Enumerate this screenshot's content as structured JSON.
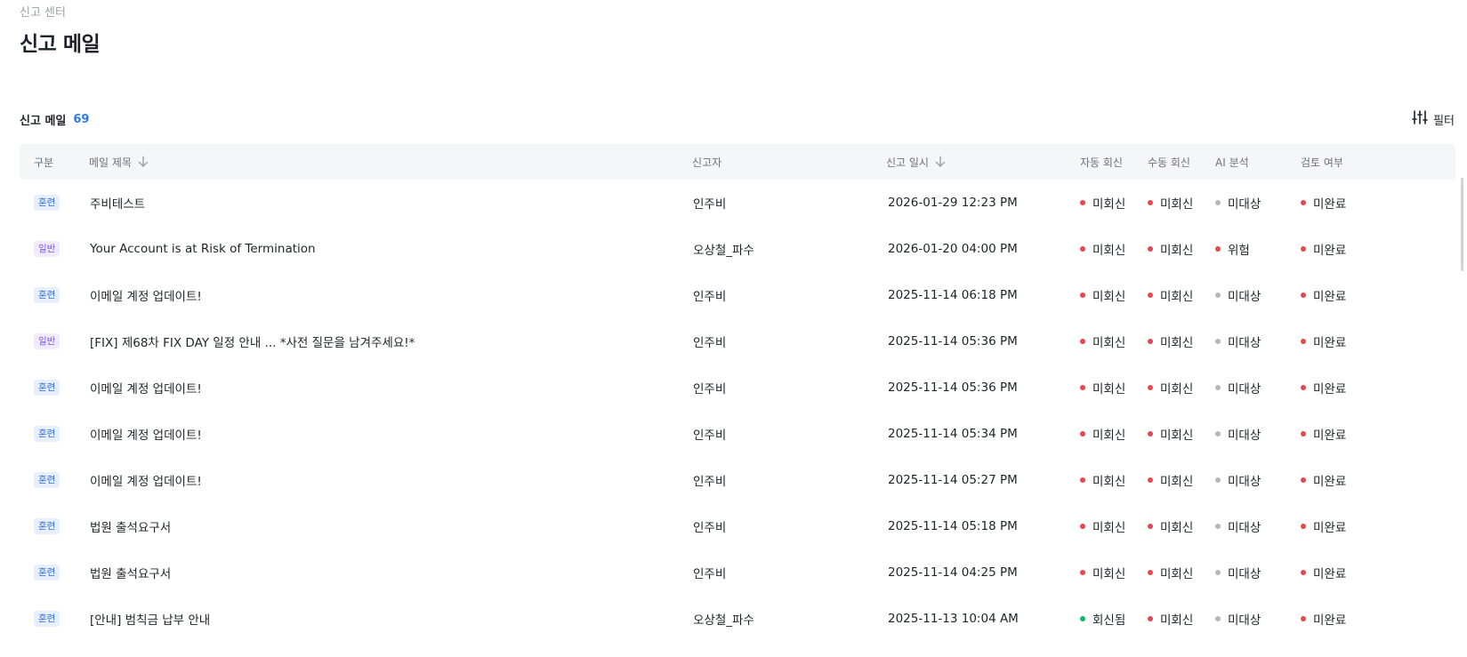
{
  "breadcrumb": "신고 센터",
  "page_title": "신고 메일",
  "list": {
    "label": "신고 메일",
    "count": "69",
    "filter_label": "필터",
    "filter_icon": "sliders-icon"
  },
  "columns": {
    "category": "구분",
    "subject": "메일 제목",
    "reporter": "신고자",
    "reported_at": "신고 일시",
    "auto_reply": "자동 회신",
    "manual_reply": "수동 회신",
    "ai_analysis": "AI 분석",
    "review": "검토 여부"
  },
  "colors": {
    "red": "#e5484d",
    "gray": "#b4b9bf",
    "green": "#12b76a",
    "accent": "#2f7ae5"
  },
  "rows": [
    {
      "category": "훈련",
      "category_type": "train",
      "subject": "주비테스트",
      "reporter": "인주비",
      "date": "2026-01-29 12:23 PM",
      "auto": "미회신",
      "auto_color": "red",
      "manual": "미회신",
      "manual_color": "red",
      "ai": "미대상",
      "ai_color": "gray",
      "review": "미완료",
      "review_color": "red"
    },
    {
      "category": "일반",
      "category_type": "normal",
      "subject": "Your Account is at Risk of Termination",
      "reporter": "오상철_파수",
      "date": "2026-01-20 04:00 PM",
      "auto": "미회신",
      "auto_color": "red",
      "manual": "미회신",
      "manual_color": "red",
      "ai": "위험",
      "ai_color": "red",
      "review": "미완료",
      "review_color": "red"
    },
    {
      "category": "훈련",
      "category_type": "train",
      "subject": "이메일 계정 업데이트!",
      "reporter": "인주비",
      "date": "2025-11-14 06:18 PM",
      "auto": "미회신",
      "auto_color": "red",
      "manual": "미회신",
      "manual_color": "red",
      "ai": "미대상",
      "ai_color": "gray",
      "review": "미완료",
      "review_color": "red"
    },
    {
      "category": "일반",
      "category_type": "normal",
      "subject": "[FIX] 제68차 FIX DAY 일정 안내 ... *사전 질문을 남겨주세요!*",
      "reporter": "인주비",
      "date": "2025-11-14 05:36 PM",
      "auto": "미회신",
      "auto_color": "red",
      "manual": "미회신",
      "manual_color": "red",
      "ai": "미대상",
      "ai_color": "gray",
      "review": "미완료",
      "review_color": "red"
    },
    {
      "category": "훈련",
      "category_type": "train",
      "subject": "이메일 계정 업데이트!",
      "reporter": "인주비",
      "date": "2025-11-14 05:36 PM",
      "auto": "미회신",
      "auto_color": "red",
      "manual": "미회신",
      "manual_color": "red",
      "ai": "미대상",
      "ai_color": "gray",
      "review": "미완료",
      "review_color": "red"
    },
    {
      "category": "훈련",
      "category_type": "train",
      "subject": "이메일 계정 업데이트!",
      "reporter": "인주비",
      "date": "2025-11-14 05:34 PM",
      "auto": "미회신",
      "auto_color": "red",
      "manual": "미회신",
      "manual_color": "red",
      "ai": "미대상",
      "ai_color": "gray",
      "review": "미완료",
      "review_color": "red"
    },
    {
      "category": "훈련",
      "category_type": "train",
      "subject": "이메일 계정 업데이트!",
      "reporter": "인주비",
      "date": "2025-11-14 05:27 PM",
      "auto": "미회신",
      "auto_color": "red",
      "manual": "미회신",
      "manual_color": "red",
      "ai": "미대상",
      "ai_color": "gray",
      "review": "미완료",
      "review_color": "red"
    },
    {
      "category": "훈련",
      "category_type": "train",
      "subject": "법원 출석요구서",
      "reporter": "인주비",
      "date": "2025-11-14 05:18 PM",
      "auto": "미회신",
      "auto_color": "red",
      "manual": "미회신",
      "manual_color": "red",
      "ai": "미대상",
      "ai_color": "gray",
      "review": "미완료",
      "review_color": "red"
    },
    {
      "category": "훈련",
      "category_type": "train",
      "subject": "법원 출석요구서",
      "reporter": "인주비",
      "date": "2025-11-14 04:25 PM",
      "auto": "미회신",
      "auto_color": "red",
      "manual": "미회신",
      "manual_color": "red",
      "ai": "미대상",
      "ai_color": "gray",
      "review": "미완료",
      "review_color": "red"
    },
    {
      "category": "훈련",
      "category_type": "train",
      "subject": "[안내] 범칙금 납부 안내",
      "reporter": "오상철_파수",
      "date": "2025-11-13 10:04 AM",
      "auto": "회신됨",
      "auto_color": "green",
      "manual": "미회신",
      "manual_color": "red",
      "ai": "미대상",
      "ai_color": "gray",
      "review": "미완료",
      "review_color": "red"
    }
  ]
}
